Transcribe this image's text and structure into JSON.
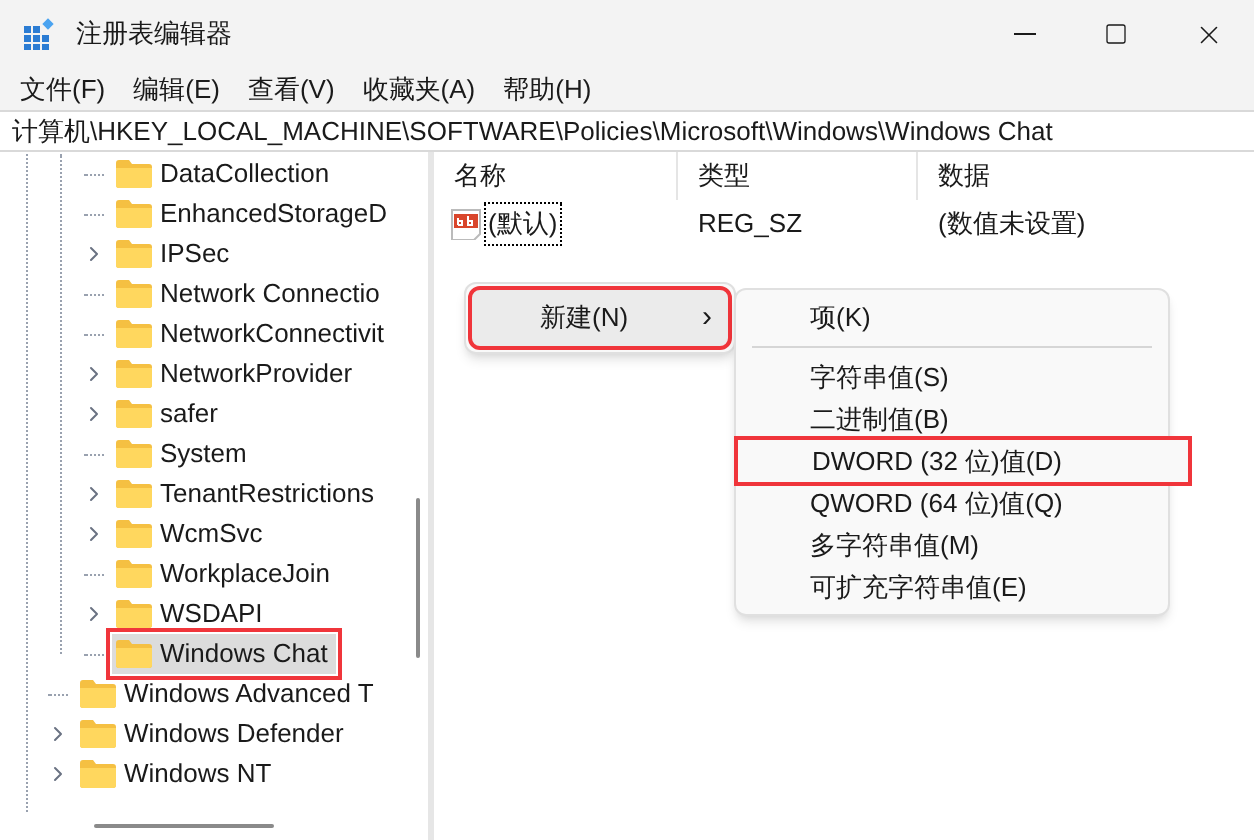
{
  "window": {
    "title": "注册表编辑器"
  },
  "menu_bar": [
    "文件(F)",
    "编辑(E)",
    "查看(V)",
    "收藏夹(A)",
    "帮助(H)"
  ],
  "address_bar": {
    "value": "计算机\\HKEY_LOCAL_MACHINE\\SOFTWARE\\Policies\\Microsoft\\Windows\\Windows Chat"
  },
  "tree": {
    "subitems": [
      {
        "label": "DataCollection",
        "expandable": false,
        "selected": false,
        "highlighted": false
      },
      {
        "label": "EnhancedStorageD",
        "expandable": false,
        "selected": false,
        "highlighted": false
      },
      {
        "label": "IPSec",
        "expandable": true,
        "selected": false,
        "highlighted": false
      },
      {
        "label": "Network Connectio",
        "expandable": false,
        "selected": false,
        "highlighted": false
      },
      {
        "label": "NetworkConnectivit",
        "expandable": false,
        "selected": false,
        "highlighted": false
      },
      {
        "label": "NetworkProvider",
        "expandable": true,
        "selected": false,
        "highlighted": false
      },
      {
        "label": "safer",
        "expandable": true,
        "selected": false,
        "highlighted": false
      },
      {
        "label": "System",
        "expandable": false,
        "selected": false,
        "highlighted": false
      },
      {
        "label": "TenantRestrictions",
        "expandable": true,
        "selected": false,
        "highlighted": false
      },
      {
        "label": "WcmSvc",
        "expandable": true,
        "selected": false,
        "highlighted": false
      },
      {
        "label": "WorkplaceJoin",
        "expandable": false,
        "selected": false,
        "highlighted": false
      },
      {
        "label": "WSDAPI",
        "expandable": true,
        "selected": false,
        "highlighted": false
      },
      {
        "label": "Windows Chat",
        "expandable": false,
        "selected": true,
        "highlighted": true
      }
    ],
    "items": [
      {
        "label": "Windows Advanced T",
        "expandable": false,
        "selected": false,
        "highlighted": false
      },
      {
        "label": "Windows Defender",
        "expandable": true,
        "selected": false,
        "highlighted": false
      },
      {
        "label": "Windows NT",
        "expandable": true,
        "selected": false,
        "highlighted": false
      }
    ]
  },
  "table": {
    "columns": [
      "名称",
      "类型",
      "数据"
    ],
    "rows": [
      {
        "name": "(默认)",
        "type": "REG_SZ",
        "data": "(数值未设置)"
      }
    ]
  },
  "context_menu": {
    "items": [
      {
        "label": "新建(N)",
        "submenu_arrow": "›",
        "highlighted": true
      }
    ]
  },
  "submenu": {
    "items": [
      {
        "kind": "item",
        "label": "项(K)",
        "highlighted": false
      },
      {
        "kind": "separator"
      },
      {
        "kind": "item",
        "label": "字符串值(S)",
        "highlighted": false
      },
      {
        "kind": "item",
        "label": "二进制值(B)",
        "highlighted": false
      },
      {
        "kind": "item",
        "label": "DWORD (32 位)值(D)",
        "highlighted": true
      },
      {
        "kind": "item",
        "label": "QWORD (64 位)值(Q)",
        "highlighted": false
      },
      {
        "kind": "item",
        "label": "多字符串值(M)",
        "highlighted": false
      },
      {
        "kind": "item",
        "label": "可扩充字符串值(E)",
        "highlighted": false
      }
    ]
  }
}
